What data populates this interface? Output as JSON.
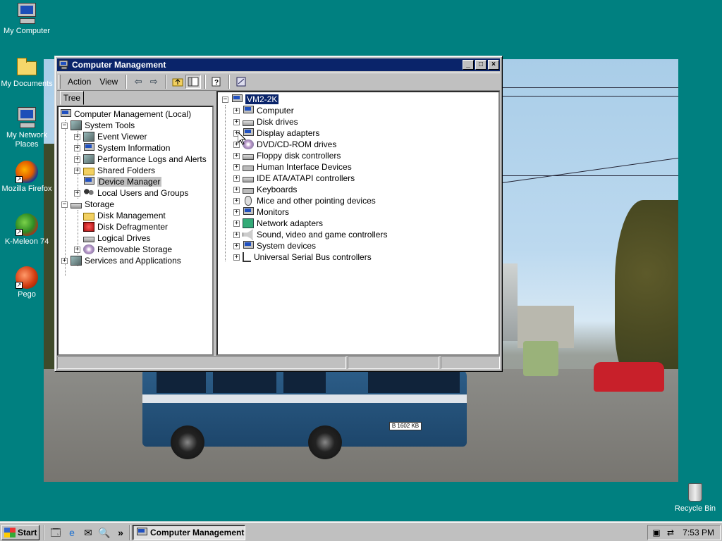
{
  "desktop": {
    "icons": [
      {
        "label": "My Computer"
      },
      {
        "label": "My Documents"
      },
      {
        "label": "My Network Places"
      },
      {
        "label": "Mozilla Firefox"
      },
      {
        "label": "K-Meleon 74"
      },
      {
        "label": "Pego"
      },
      {
        "label": "Recycle Bin"
      }
    ],
    "background_color": "#008080",
    "bus_plate": "B 1602 KB"
  },
  "window": {
    "title": "Computer Management",
    "menu": {
      "action": "Action",
      "view": "View"
    },
    "tree_tab": "Tree",
    "left_tree": [
      {
        "label": "Computer Management (Local)",
        "level": 0,
        "expander": "none",
        "icon": "pc-icon"
      },
      {
        "label": "System Tools",
        "level": 1,
        "expander": "minus",
        "icon": "tools-icon"
      },
      {
        "label": "Event Viewer",
        "level": 2,
        "expander": "plus",
        "icon": "event-viewer-icon"
      },
      {
        "label": "System Information",
        "level": 2,
        "expander": "plus",
        "icon": "system-info-icon"
      },
      {
        "label": "Performance Logs and Alerts",
        "level": 2,
        "expander": "plus",
        "icon": "perf-logs-icon"
      },
      {
        "label": "Shared Folders",
        "level": 2,
        "expander": "plus",
        "icon": "folder-icon"
      },
      {
        "label": "Device Manager",
        "level": 2,
        "expander": "none",
        "icon": "device-manager-icon",
        "selected": true
      },
      {
        "label": "Local Users and Groups",
        "level": 2,
        "expander": "plus",
        "icon": "users-icon"
      },
      {
        "label": "Storage",
        "level": 1,
        "expander": "minus",
        "icon": "storage-icon"
      },
      {
        "label": "Disk Management",
        "level": 2,
        "expander": "none",
        "icon": "folder-icon"
      },
      {
        "label": "Disk Defragmenter",
        "level": 2,
        "expander": "none",
        "icon": "defrag-icon"
      },
      {
        "label": "Logical Drives",
        "level": 2,
        "expander": "none",
        "icon": "drive-icon"
      },
      {
        "label": "Removable Storage",
        "level": 2,
        "expander": "plus",
        "icon": "removable-storage-icon"
      },
      {
        "label": "Services and Applications",
        "level": 1,
        "expander": "plus",
        "icon": "services-icon"
      }
    ],
    "right_tree": {
      "root": "VM2-2K",
      "items": [
        {
          "label": "Computer",
          "icon": "pc-icon"
        },
        {
          "label": "Disk drives",
          "icon": "disk-icon"
        },
        {
          "label": "Display adapters",
          "icon": "monitor-icon"
        },
        {
          "label": "DVD/CD-ROM drives",
          "icon": "cd-icon"
        },
        {
          "label": "Floppy disk controllers",
          "icon": "floppy-icon"
        },
        {
          "label": "Human Interface Devices",
          "icon": "hid-icon"
        },
        {
          "label": "IDE ATA/ATAPI controllers",
          "icon": "ide-icon"
        },
        {
          "label": "Keyboards",
          "icon": "keyboard-icon"
        },
        {
          "label": "Mice and other pointing devices",
          "icon": "mouse-icon"
        },
        {
          "label": "Monitors",
          "icon": "monitor-icon"
        },
        {
          "label": "Network adapters",
          "icon": "network-icon"
        },
        {
          "label": "Sound, video and game controllers",
          "icon": "sound-icon"
        },
        {
          "label": "System devices",
          "icon": "pc-icon"
        },
        {
          "label": "Universal Serial Bus controllers",
          "icon": "usb-icon"
        }
      ]
    },
    "title_buttons": {
      "minimize": "_",
      "maximize": "□",
      "close": "×"
    }
  },
  "taskbar": {
    "start_label": "Start",
    "task_label": "Computer Management",
    "quicklaunch_more": "»",
    "clock": "7:53 PM"
  }
}
